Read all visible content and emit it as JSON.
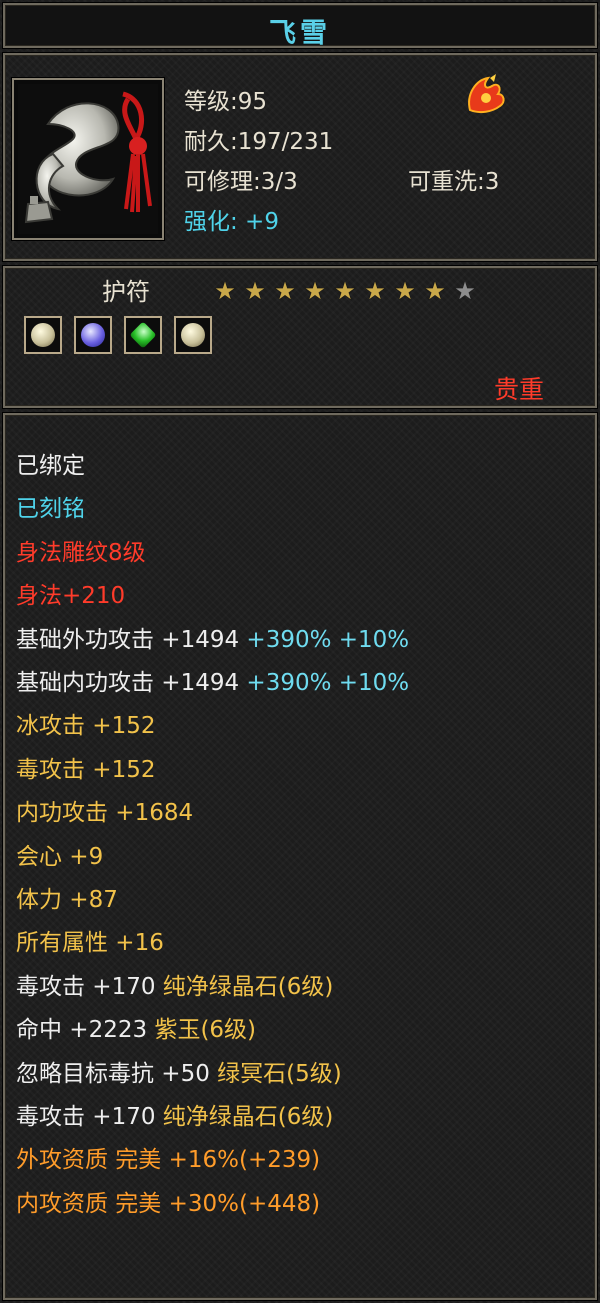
{
  "item": {
    "name": "飞雪",
    "level_label": "等级:95",
    "durability_label": "耐久:197/231",
    "repair_label": "可修理:3/3",
    "rewash_label": "可重洗:3",
    "enhance_label": "强化: +9",
    "type_label": "护符",
    "stars_filled": 8,
    "stars_total": 9,
    "rarity_label": "贵重",
    "badge_icon": "phoenix-badge-icon",
    "gem_icons": [
      "white-gem-icon",
      "purple-gem-icon",
      "green-gem-icon",
      "white-gem-icon"
    ]
  },
  "attributes": [
    {
      "text": "已绑定",
      "color": "#eeeeee"
    },
    {
      "text": "已刻铭",
      "color": "#4fd3ea"
    },
    {
      "text": "身法雕纹8级",
      "color": "#ff3b2a"
    },
    {
      "text": "身法+210",
      "color": "#ff3b2a"
    },
    {
      "text": "基础外功攻击 +1494",
      "color": "#eeeeee",
      "extra": " +390% +10%",
      "extra_color": "#6fdcf0"
    },
    {
      "text": "基础内功攻击 +1494",
      "color": "#eeeeee",
      "extra": " +390% +10%",
      "extra_color": "#6fdcf0"
    },
    {
      "text": "冰攻击 +152",
      "color": "#f2c24a"
    },
    {
      "text": "毒攻击 +152",
      "color": "#f2c24a"
    },
    {
      "text": "内功攻击 +1684",
      "color": "#f2c24a"
    },
    {
      "text": "会心 +9",
      "color": "#f2c24a"
    },
    {
      "text": "体力 +87",
      "color": "#f2c24a"
    },
    {
      "text": "所有属性 +16",
      "color": "#f2c24a"
    },
    {
      "text": "毒攻击 +170 ",
      "color": "#eeeeee",
      "extra": "纯净绿晶石(6级)",
      "extra_color": "#f2c24a"
    },
    {
      "text": "命中 +2223 ",
      "color": "#eeeeee",
      "extra": "紫玉(6级)",
      "extra_color": "#f2c24a"
    },
    {
      "text": "忽略目标毒抗 +50 ",
      "color": "#eeeeee",
      "extra": "绿冥石(5级)",
      "extra_color": "#f2c24a"
    },
    {
      "text": "毒攻击 +170 ",
      "color": "#eeeeee",
      "extra": "纯净绿晶石(6级)",
      "extra_color": "#f2c24a"
    },
    {
      "text": "外攻资质 完美 +16%(+239)",
      "color": "#ff9c2a"
    },
    {
      "text": "内攻资质 完美 +30%(+448)",
      "color": "#ff9c2a"
    }
  ]
}
